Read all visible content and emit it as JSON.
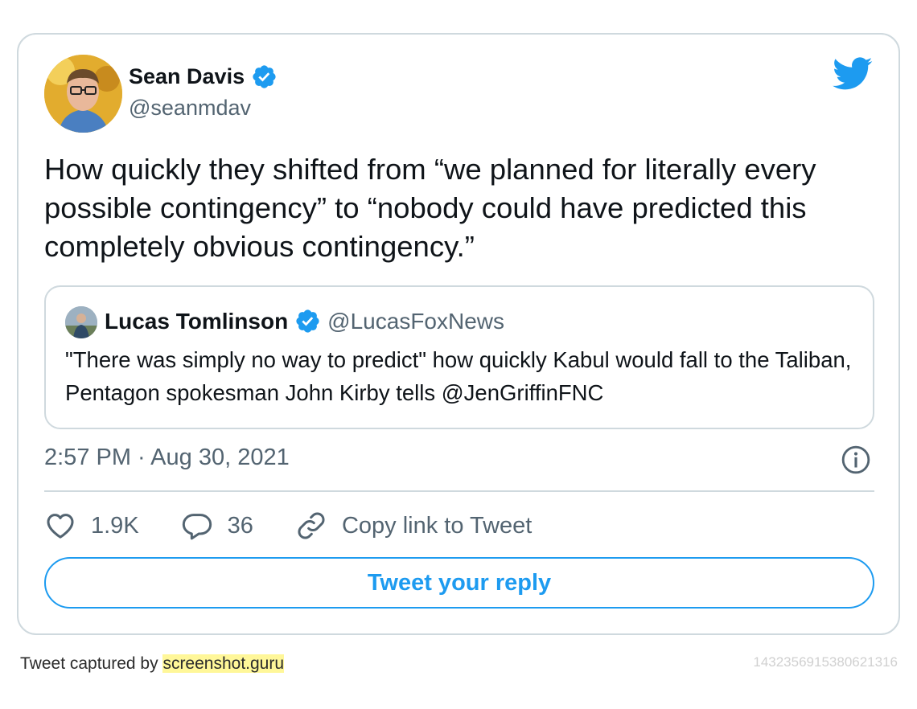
{
  "tweet": {
    "author": {
      "name": "Sean Davis",
      "handle": "@seanmdav"
    },
    "text": "How quickly they shifted from “we planned for literally every possible contingency” to “nobody could have predicted this completely obvious contingency.”",
    "quoted": {
      "name": "Lucas Tomlinson",
      "handle": "@LucasFoxNews",
      "text": "\"There was simply no way to predict\" how quickly Kabul would fall to the Taliban, Pentagon spokesman John Kirby tells @JenGriffinFNC"
    },
    "timestamp": "2:57 PM · Aug 30, 2021",
    "actions": {
      "likes": "1.9K",
      "replies": "36",
      "copy_link": "Copy link to Tweet"
    },
    "reply_button": "Tweet your reply"
  },
  "footer": {
    "caption_prefix": "Tweet captured by ",
    "caption_link": "screenshot.guru",
    "tweet_id": "1432356915380621316"
  },
  "colors": {
    "accent": "#1d9bf0",
    "text": "#0f1419",
    "muted": "#536471",
    "border": "#cfd9de"
  },
  "icons": [
    "verified-badge-icon",
    "twitter-bird-icon",
    "info-icon",
    "heart-icon",
    "reply-bubble-icon",
    "link-icon"
  ]
}
